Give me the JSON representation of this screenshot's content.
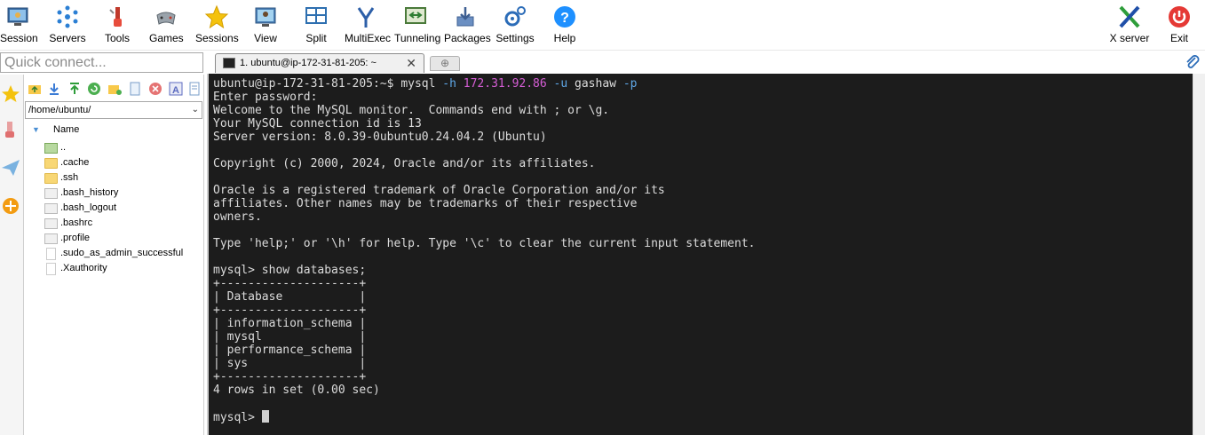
{
  "toolbar": {
    "items": [
      {
        "label": "Session",
        "icon": "session-icon"
      },
      {
        "label": "Servers",
        "icon": "servers-icon"
      },
      {
        "label": "Tools",
        "icon": "tools-icon"
      },
      {
        "label": "Games",
        "icon": "games-icon"
      },
      {
        "label": "Sessions",
        "icon": "sessions-star-icon"
      },
      {
        "label": "View",
        "icon": "view-icon"
      },
      {
        "label": "Split",
        "icon": "split-icon"
      },
      {
        "label": "MultiExec",
        "icon": "multiexec-icon"
      },
      {
        "label": "Tunneling",
        "icon": "tunneling-icon"
      },
      {
        "label": "Packages",
        "icon": "packages-icon"
      },
      {
        "label": "Settings",
        "icon": "settings-icon"
      },
      {
        "label": "Help",
        "icon": "help-icon"
      }
    ],
    "xserver_label": "X server",
    "exit_label": "Exit"
  },
  "quick_connect": {
    "placeholder": "Quick connect..."
  },
  "tabs": {
    "active_label": "1. ubuntu@ip-172-31-81-205: ~",
    "close_glyph": "✕",
    "new_tab_glyph": "⊕"
  },
  "file_panel": {
    "path": "/home/ubuntu/",
    "column_header": "Name",
    "items": [
      {
        "name": "..",
        "type": "up"
      },
      {
        "name": ".cache",
        "type": "folder"
      },
      {
        "name": ".ssh",
        "type": "folder"
      },
      {
        "name": ".bash_history",
        "type": "file"
      },
      {
        "name": ".bash_logout",
        "type": "file"
      },
      {
        "name": ".bashrc",
        "type": "file"
      },
      {
        "name": ".profile",
        "type": "file"
      },
      {
        "name": ".sudo_as_admin_successful",
        "type": "doc"
      },
      {
        "name": ".Xauthority",
        "type": "doc"
      }
    ]
  },
  "terminal": {
    "prompt": "ubuntu@ip-172-31-81-205:~$ ",
    "command": {
      "cmd": "mysql ",
      "opt_h": "-h ",
      "host": "172.31.92.86",
      "opt_u": " -u ",
      "user": "gashaw ",
      "opt_p": "-p"
    },
    "output_lines": [
      "Enter password:",
      "Welcome to the MySQL monitor.  Commands end with ; or \\g.",
      "Your MySQL connection id is 13",
      "Server version: 8.0.39-0ubuntu0.24.04.2 (Ubuntu)",
      "",
      "Copyright (c) 2000, 2024, Oracle and/or its affiliates.",
      "",
      "Oracle is a registered trademark of Oracle Corporation and/or its",
      "affiliates. Other names may be trademarks of their respective",
      "owners.",
      "",
      "Type 'help;' or '\\h' for help. Type '\\c' to clear the current input statement.",
      "",
      "mysql> show databases;",
      "+--------------------+",
      "| Database           |",
      "+--------------------+",
      "| information_schema |",
      "| mysql              |",
      "| performance_schema |",
      "| sys                |",
      "+--------------------+",
      "4 rows in set (0.00 sec)",
      ""
    ],
    "final_prompt": "mysql> "
  },
  "colors": {
    "terminal_bg": "#1c1c1c",
    "terminal_fg": "#dcdcdc",
    "option_color": "#5fa8e8",
    "ip_color": "#d65ed6"
  }
}
